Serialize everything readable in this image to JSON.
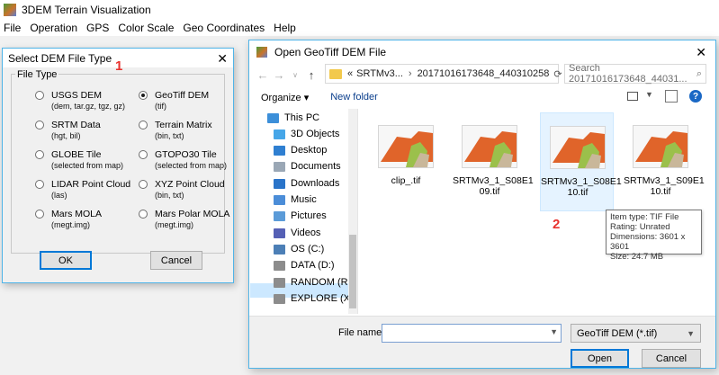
{
  "app": {
    "title": "3DEM Terrain Visualization",
    "menu": [
      "File",
      "Operation",
      "GPS",
      "Color Scale",
      "Geo Coordinates",
      "Help"
    ]
  },
  "dialog1": {
    "title": "Select DEM File Type",
    "group_label": "File Type",
    "marker": "1",
    "options": [
      {
        "label": "USGS DEM",
        "sub": "(dem, tar.gz, tgz, gz)",
        "selected": false
      },
      {
        "label": "GeoTiff DEM",
        "sub": "(tif)",
        "selected": true
      },
      {
        "label": "SRTM Data",
        "sub": "(hgt, bil)",
        "selected": false
      },
      {
        "label": "Terrain Matrix",
        "sub": "(bin, txt)",
        "selected": false
      },
      {
        "label": "GLOBE Tile",
        "sub": "(selected from map)",
        "selected": false
      },
      {
        "label": "GTOPO30 Tile",
        "sub": "(selected from map)",
        "selected": false
      },
      {
        "label": "LIDAR Point Cloud",
        "sub": "(las)",
        "selected": false
      },
      {
        "label": "XYZ Point Cloud",
        "sub": "(bin, txt)",
        "selected": false
      },
      {
        "label": "Mars MOLA",
        "sub": "(megt.img)",
        "selected": false
      },
      {
        "label": "Mars Polar MOLA",
        "sub": "(megt.img)",
        "selected": false
      }
    ],
    "ok_label": "OK",
    "cancel_label": "Cancel"
  },
  "dialog2": {
    "title": "Open GeoTiff DEM File",
    "breadcrumb": {
      "prefix": "«",
      "part1": "SRTMv3...",
      "part2": "20171016173648_440310258"
    },
    "search_placeholder": "Search 20171016173648_44031...",
    "organize_label": "Organize ▾",
    "new_folder_label": "New folder",
    "nav_items": [
      {
        "label": "This PC",
        "icon": "computer-icon",
        "color": "#3c8fd9"
      },
      {
        "label": "3D Objects",
        "icon": "cube-icon",
        "color": "#46a6e8"
      },
      {
        "label": "Desktop",
        "icon": "desktop-icon",
        "color": "#2f7fd1"
      },
      {
        "label": "Documents",
        "icon": "documents-icon",
        "color": "#9aa7b5"
      },
      {
        "label": "Downloads",
        "icon": "download-icon",
        "color": "#2a74c9"
      },
      {
        "label": "Music",
        "icon": "music-icon",
        "color": "#4b8dd8"
      },
      {
        "label": "Pictures",
        "icon": "pictures-icon",
        "color": "#5b9bd8"
      },
      {
        "label": "Videos",
        "icon": "videos-icon",
        "color": "#5560b5"
      },
      {
        "label": "OS (C:)",
        "icon": "drive-icon",
        "color": "#4c7fb6"
      },
      {
        "label": "DATA (D:)",
        "icon": "drive-icon",
        "color": "#8c8c8c"
      },
      {
        "label": "RANDOM (R:)",
        "icon": "drive-icon",
        "color": "#8c8c8c"
      },
      {
        "label": "EXPLORE (X:)",
        "icon": "drive-icon",
        "color": "#8c8c8c"
      }
    ],
    "files": [
      {
        "name1": "clip_.tif",
        "name2": ""
      },
      {
        "name1": "SRTMv3_1_S08E1",
        "name2": "09.tif"
      },
      {
        "name1": "SRTMv3_1_S08E1",
        "name2": "10.tif"
      },
      {
        "name1": "SRTMv3_1_S09E1",
        "name2": "10.tif"
      }
    ],
    "marker": "2",
    "tooltip": {
      "type": "Item type: TIF File",
      "rating": "Rating: Unrated",
      "dimensions": "Dimensions: 3601 x 3601",
      "size": "Size: 24.7 MB"
    },
    "filename_label": "File name:",
    "filename_value": "",
    "filter_label": "GeoTiff DEM (*.tif)",
    "open_label": "Open",
    "cancel_label": "Cancel"
  }
}
